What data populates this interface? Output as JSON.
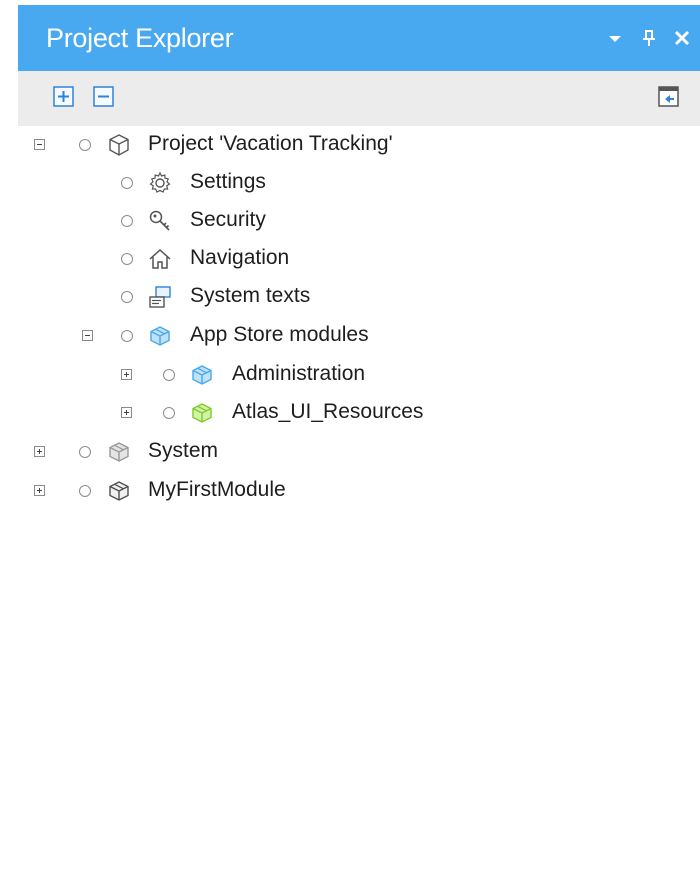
{
  "panel": {
    "title": "Project Explorer",
    "controls": [
      {
        "name": "dropdown-icon",
        "glyph": "▾"
      },
      {
        "name": "pin-icon",
        "glyph": "📌"
      },
      {
        "name": "close-icon",
        "glyph": "✕"
      }
    ],
    "accent_color": "#49a9f0",
    "toolbar": {
      "expand_all": "expand-all-icon",
      "collapse_all": "collapse-all-icon",
      "link_editor": "sync-editor-icon"
    }
  },
  "tree": [
    {
      "label": "Project 'Vacation Tracking'",
      "icon": "project-cube-icon",
      "expander": "minus"
    },
    {
      "label": "Settings",
      "icon": "gear-icon"
    },
    {
      "label": "Security",
      "icon": "key-icon"
    },
    {
      "label": "Navigation",
      "icon": "home-icon"
    },
    {
      "label": "System texts",
      "icon": "system-texts-icon"
    },
    {
      "label": "App Store modules",
      "icon": "appstore-module-icon",
      "expander": "minus"
    },
    {
      "label": "Administration",
      "icon": "blue-module-icon",
      "expander": "plus"
    },
    {
      "label": "Atlas_UI_Resources",
      "icon": "green-module-icon",
      "expander": "plus"
    },
    {
      "label": "System",
      "icon": "gray-module-icon",
      "expander": "plus"
    },
    {
      "label": "MyFirstModule",
      "icon": "dark-module-icon",
      "expander": "plus"
    }
  ],
  "colors": {
    "blue_module": "#4aa8e8",
    "green_module": "#7ccc2a",
    "gray_module": "#b9b9b9",
    "dark_module": "#5a5a5a"
  }
}
